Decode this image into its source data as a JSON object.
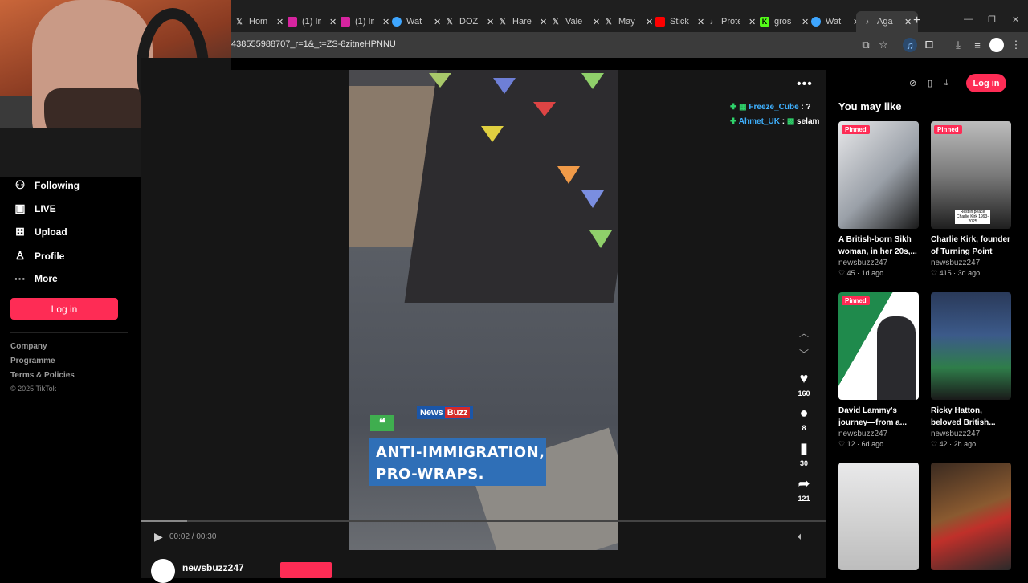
{
  "browser": {
    "tabs": [
      {
        "label": "Hom",
        "icon": "x-icon"
      },
      {
        "label": "(1) In",
        "icon": "instagram-icon"
      },
      {
        "label": "(1) In",
        "icon": "instagram-icon"
      },
      {
        "label": "Wat",
        "icon": "watch-icon"
      },
      {
        "label": "DOZ",
        "icon": "x-icon"
      },
      {
        "label": "Hare",
        "icon": "x-icon"
      },
      {
        "label": "Vale",
        "icon": "x-icon"
      },
      {
        "label": "May",
        "icon": "x-icon"
      },
      {
        "label": "Stick",
        "icon": "youtube-icon"
      },
      {
        "label": "Prote",
        "icon": "tiktok-icon"
      },
      {
        "label": "gros",
        "icon": "kick-icon"
      },
      {
        "label": "Wat",
        "icon": "watch-icon"
      },
      {
        "label": "Aga",
        "icon": "tiktok-icon",
        "active": true
      }
    ],
    "url": "438555988707_r=1&_t=ZS-8zitneHPNNU"
  },
  "sidebar": {
    "items": [
      {
        "label": "Following",
        "icon": "following-icon"
      },
      {
        "label": "LIVE",
        "icon": "live-icon"
      },
      {
        "label": "Upload",
        "icon": "upload-icon"
      },
      {
        "label": "Profile",
        "icon": "profile-icon"
      },
      {
        "label": "More",
        "icon": "more-icon"
      }
    ],
    "login": "Log in",
    "footer": [
      "Company",
      "Programme",
      "Terms & Policies"
    ],
    "copyright": "© 2025 TikTok"
  },
  "video": {
    "brand": "News",
    "brand2": "Buzz",
    "caption_line1": "ANTI-IMMIGRATION,",
    "caption_line2": "PRO-WRAPS.",
    "time": "00:02 / 00:30",
    "progress": 0.067,
    "author": "newsbuzz247"
  },
  "chat": [
    {
      "user": "Freeze_Cube",
      "message": "?"
    },
    {
      "user": "Ahmet_UK",
      "message": "selam"
    }
  ],
  "actions": {
    "likes": "160",
    "comments": "8",
    "saves": "30",
    "shares": "121"
  },
  "right": {
    "login": "Log in",
    "heading": "You may like",
    "cards": [
      {
        "pinned": "Pinned",
        "title": "A British-born Sikh woman, in her 20s,...",
        "author": "newsbuzz247",
        "meta": "♡ 45 · 1d ago"
      },
      {
        "pinned": "Pinned",
        "title": "Charlie Kirk, founder of Turning Point US...",
        "author": "newsbuzz247",
        "meta": "♡ 415 · 3d ago",
        "thumb_text": "Rest in peace Charlie Kirk 1993-2025"
      },
      {
        "pinned": "Pinned",
        "title": "David Lammy's journey—from a...",
        "author": "newsbuzz247",
        "meta": "♡ 12 · 6d ago"
      },
      {
        "pinned": "",
        "title": "Ricky Hatton, beloved British...",
        "author": "newsbuzz247",
        "meta": "♡ 42 · 2h ago"
      },
      {
        "pinned": "",
        "title": "",
        "author": "",
        "meta": ""
      },
      {
        "pinned": "",
        "title": "",
        "author": "",
        "meta": ""
      }
    ]
  },
  "colors": {
    "accent": "#fe2c55",
    "caption_bg": "#2f6fb7"
  }
}
